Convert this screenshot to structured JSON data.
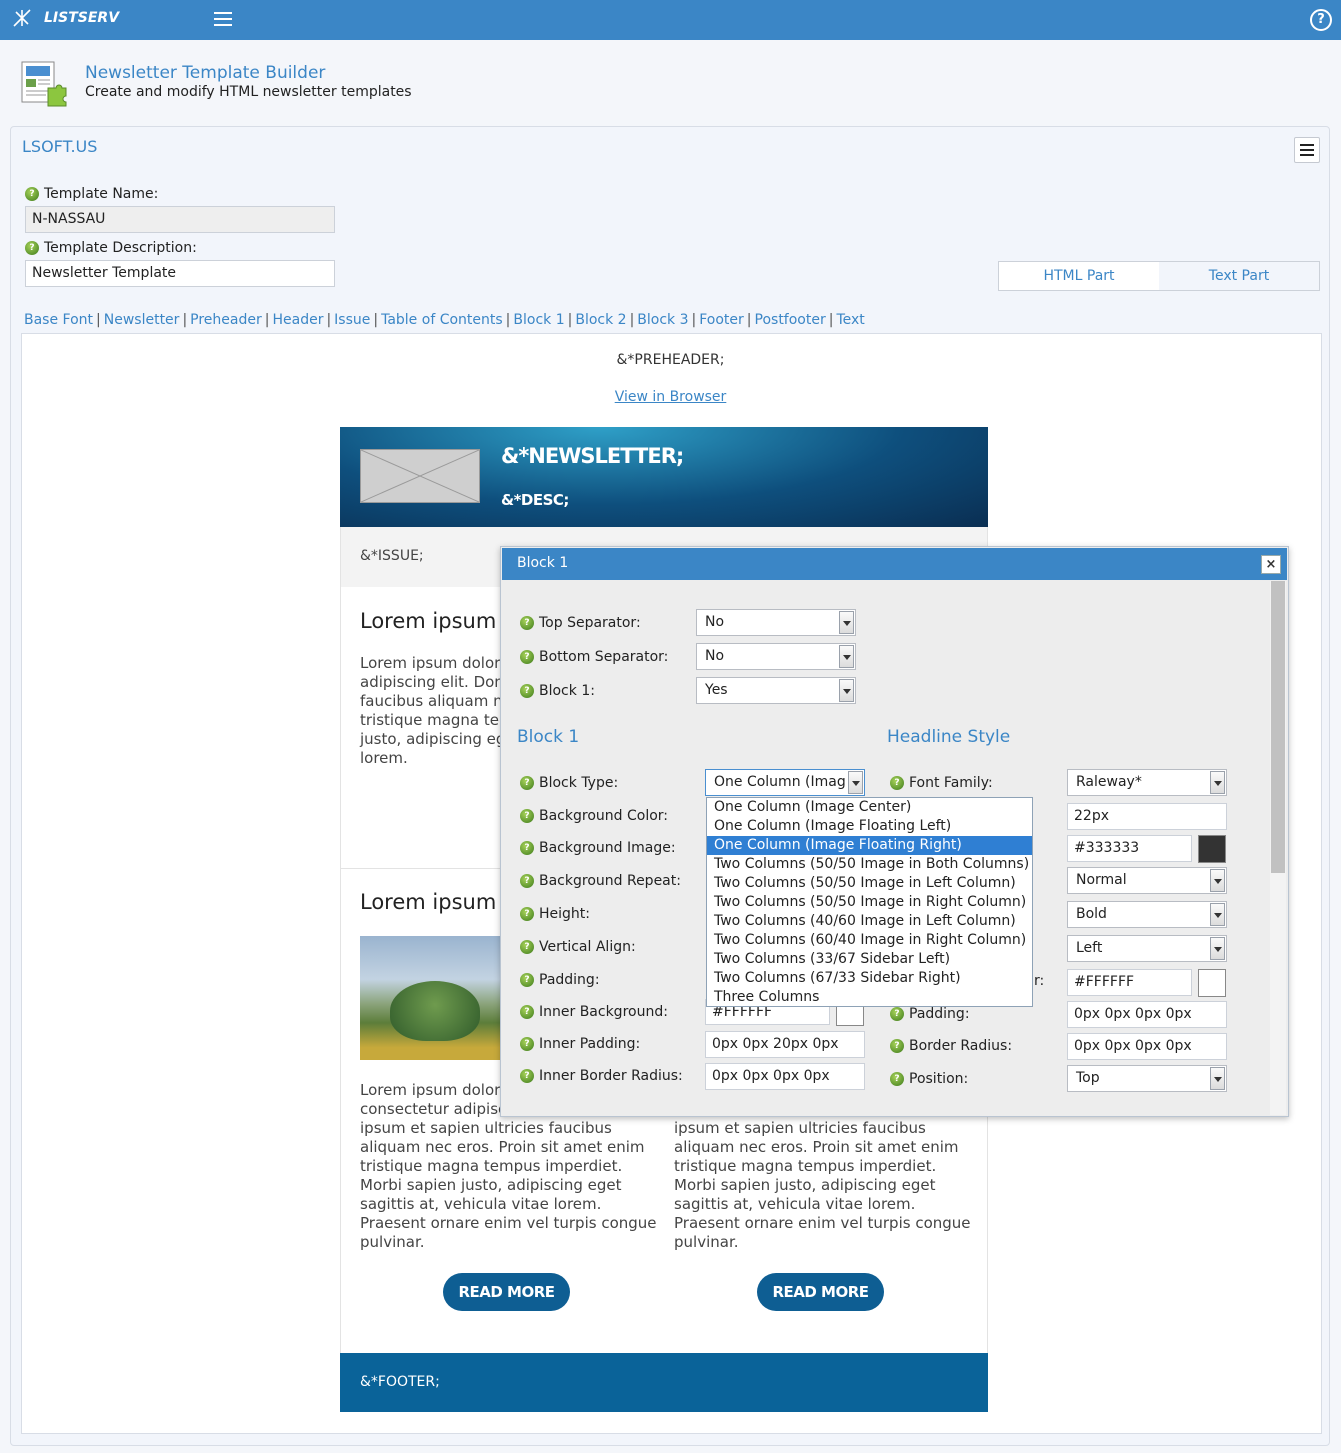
{
  "topbar": {
    "brand": "LISTSERV",
    "help_glyph": "?"
  },
  "header": {
    "title": "Newsletter Template Builder",
    "subtitle": "Create and modify HTML newsletter templates"
  },
  "panel": {
    "list_name": "LSOFT.US"
  },
  "form": {
    "template_name_label": "Template Name:",
    "template_name_value": "N-NASSAU",
    "template_desc_label": "Template Description:",
    "template_desc_value": "Newsletter Template"
  },
  "parts_toggle": {
    "html": "HTML Part",
    "text": "Text Part"
  },
  "nav": [
    "Base Font",
    "Newsletter",
    "Preheader",
    "Header",
    "Issue",
    "Table of Contents",
    "Block 1",
    "Block 2",
    "Block 3",
    "Footer",
    "Postfooter",
    "Text"
  ],
  "preview": {
    "preheader": "&*PREHEADER;",
    "view_in_browser": "View in Browser",
    "newsletter": "&*NEWSLETTER;",
    "desc": "&*DESC;",
    "issue": "&*ISSUE;",
    "block1_heading": "Lorem ipsum",
    "block1_text_lines": [
      "Lorem ipsum dolor",
      "adipiscing elit. Don",
      "faucibus aliquam n",
      "tristique magna ter",
      "justo, adipiscing eg",
      "lorem."
    ],
    "block2_heading": "Lorem ipsum",
    "col1_text_lines": [
      "Lorem ipsum dolor",
      "consectetur adipisc",
      "ipsum et sapien ultricies faucibus",
      "aliquam nec eros. Proin sit amet enim",
      "tristique magna tempus imperdiet.",
      "Morbi sapien justo, adipiscing eget",
      "sagittis at, vehicula vitae lorem.",
      "Praesent ornare enim vel turpis congue",
      "pulvinar."
    ],
    "col2_text_lines": [
      "ipsum et sapien ultricies faucibus",
      "aliquam nec eros. Proin sit amet enim",
      "tristique magna tempus imperdiet.",
      "Morbi sapien justo, adipiscing eget",
      "sagittis at, vehicula vitae lorem.",
      "Praesent ornare enim vel turpis congue",
      "pulvinar."
    ],
    "read_more": "READ MORE",
    "footer": "&*FOOTER;"
  },
  "dialog": {
    "title": "Block 1",
    "close_glyph": "×",
    "top_separator_label": "Top Separator:",
    "top_separator_value": "No",
    "bottom_separator_label": "Bottom Separator:",
    "bottom_separator_value": "No",
    "block1_label": "Block 1:",
    "block1_value": "Yes",
    "left_section": "Block 1",
    "right_section": "Headline Style",
    "left_fields": [
      {
        "label": "Block Type:"
      },
      {
        "label": "Background Color:"
      },
      {
        "label": "Background Image:"
      },
      {
        "label": "Background Repeat:"
      },
      {
        "label": "Height:"
      },
      {
        "label": "Vertical Align:"
      },
      {
        "label": "Padding:"
      },
      {
        "label": "Inner Background:"
      },
      {
        "label": "Inner Padding:"
      },
      {
        "label": "Inner Border Radius:"
      }
    ],
    "block_type_value": "One Column (Imag",
    "inner_background_value": "#FFFFFF",
    "inner_padding_value": "0px 0px 20px 0px",
    "inner_border_radius_value": "0px 0px 0px 0px",
    "font_family_label": "Font Family:",
    "font_family_value": "Raleway*",
    "font_size_value": "22px",
    "font_color_value": "#333333",
    "font_style_value": "Normal",
    "font_weight_value": "Bold",
    "text_align_value": "Left",
    "bg_color_label_tail": "r:",
    "bg_color_value": "#FFFFFF",
    "padding_label": "Padding:",
    "padding_value": "0px 0px 0px 0px",
    "border_radius_label": "Border Radius:",
    "border_radius_value": "0px 0px 0px 0px",
    "position_label": "Position:",
    "position_value": "Top",
    "dropdown_options": [
      "One Column (Image Center)",
      "One Column (Image Floating Left)",
      "One Column (Image Floating Right)",
      "Two Columns (50/50 Image in Both Columns)",
      "Two Columns (50/50 Image in Left Column)",
      "Two Columns (50/50 Image in Right Column)",
      "Two Columns (40/60 Image in Left Column)",
      "Two Columns (60/40 Image in Right Column)",
      "Two Columns (33/67 Sidebar Left)",
      "Two Columns (67/33 Sidebar Right)",
      "Three Columns"
    ],
    "dropdown_selected_index": 2
  },
  "colors": {
    "accent": "#3b86c6",
    "header_dark": "#0a2e52",
    "footer": "#0a6399",
    "button": "#0e5e93",
    "selected": "#2f7fd3"
  }
}
